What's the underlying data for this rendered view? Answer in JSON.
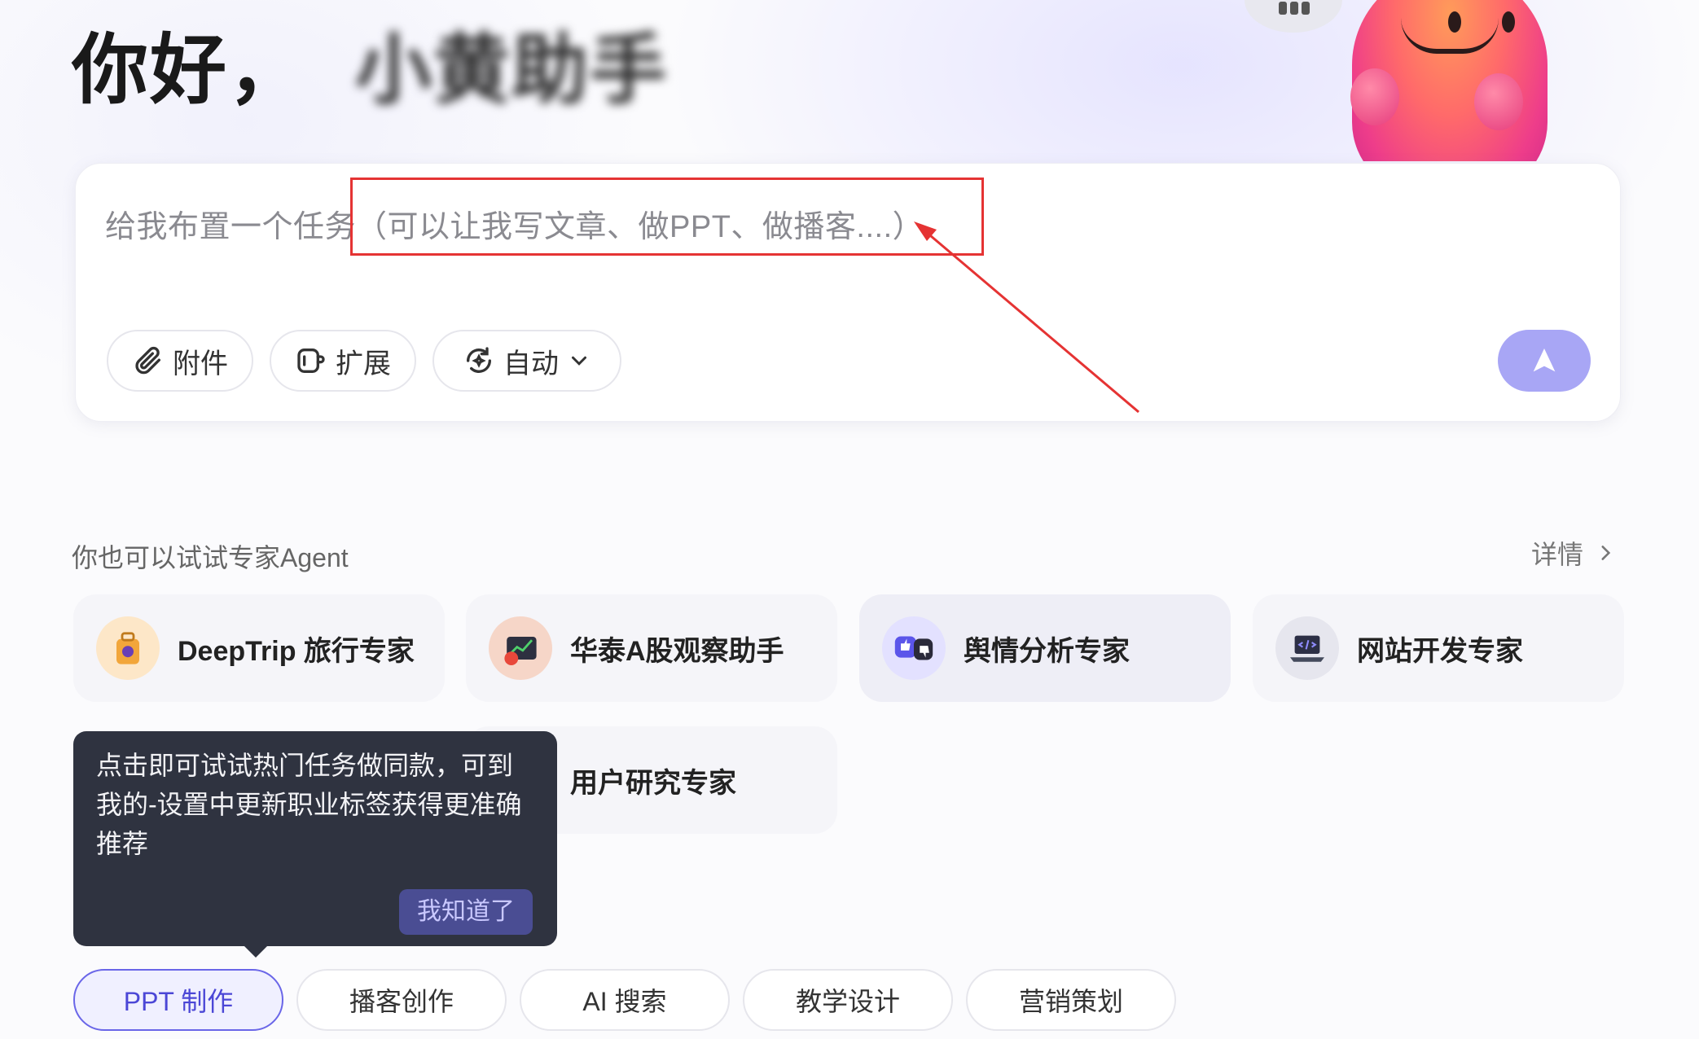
{
  "greeting": {
    "text": "你好，",
    "name": "小黄助手"
  },
  "input": {
    "placeholder": "给我布置一个任务（可以让我写文章、做PPT、做播客....）",
    "tools": {
      "attach_label": "附件",
      "extend_label": "扩展",
      "mode_label": "自动"
    },
    "send_icon": "send-arrow-icon"
  },
  "experts": {
    "section_title": "你也可以试试专家Agent",
    "details_label": "详情",
    "cards": [
      {
        "label": "DeepTrip 旅行专家",
        "icon": "suitcase-icon"
      },
      {
        "label": "华泰A股观察助手",
        "icon": "stock-chart-icon"
      },
      {
        "label": "舆情分析专家",
        "icon": "thumbs-icon"
      },
      {
        "label": "网站开发专家",
        "icon": "laptop-code-icon"
      },
      {
        "label": "用户研究专家",
        "icon": "user-research-icon"
      }
    ]
  },
  "tooltip": {
    "text": "点击即可试试热门任务做同款，可到我的-设置中更新职业标签获得更准确推荐",
    "button_label": "我知道了"
  },
  "categories": [
    {
      "label": "PPT 制作",
      "active": true
    },
    {
      "label": "播客创作",
      "active": false
    },
    {
      "label": "AI 搜索",
      "active": false
    },
    {
      "label": "教学设计",
      "active": false
    },
    {
      "label": "营销策划",
      "active": false
    }
  ],
  "colors": {
    "accent": "#6a66e8",
    "send_button": "#a8a6f5",
    "annotation": "#e53333",
    "tooltip_bg": "#2f3340"
  }
}
